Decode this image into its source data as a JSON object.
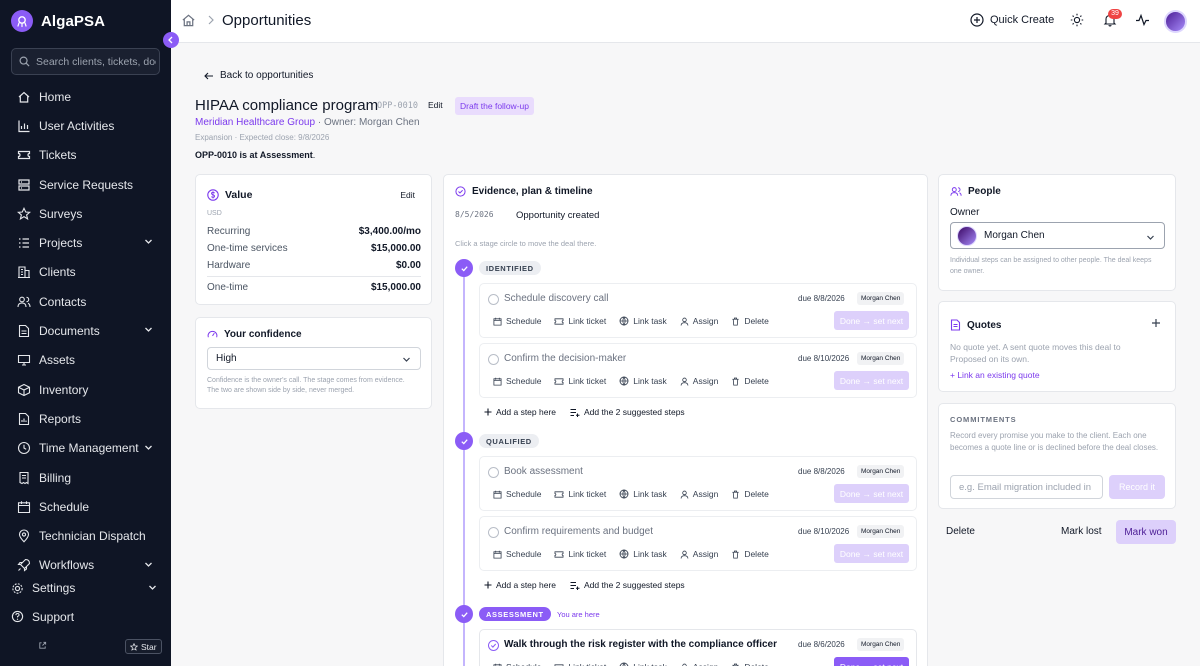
{
  "app": {
    "name": "AlgaPSA"
  },
  "search": {
    "placeholder": "Search clients, tickets, doc"
  },
  "nav": [
    {
      "label": "Home",
      "icon": "home-icon"
    },
    {
      "label": "User Activities",
      "icon": "chart-bar-icon"
    },
    {
      "label": "Tickets",
      "icon": "ticket-icon"
    },
    {
      "label": "Service Requests",
      "icon": "grid-icon"
    },
    {
      "label": "Surveys",
      "icon": "star-icon"
    },
    {
      "label": "Projects",
      "icon": "list-icon",
      "expandable": true
    },
    {
      "label": "Clients",
      "icon": "building-icon"
    },
    {
      "label": "Contacts",
      "icon": "users-icon"
    },
    {
      "label": "Documents",
      "icon": "document-icon",
      "expandable": true
    },
    {
      "label": "Assets",
      "icon": "monitor-icon"
    },
    {
      "label": "Inventory",
      "icon": "box-icon"
    },
    {
      "label": "Reports",
      "icon": "report-icon"
    },
    {
      "label": "Time Management",
      "icon": "clock-icon",
      "expandable": true
    },
    {
      "label": "Billing",
      "icon": "billing-icon"
    },
    {
      "label": "Schedule",
      "icon": "calendar-icon"
    },
    {
      "label": "Technician Dispatch",
      "icon": "pin-icon"
    },
    {
      "label": "Workflows",
      "icon": "rocket-icon",
      "expandable": true
    }
  ],
  "sidebar_bottom": {
    "settings": "Settings",
    "support": "Support",
    "star": "Star"
  },
  "topbar": {
    "title": "Opportunities",
    "quick_create": "Quick Create",
    "notif_count": "39"
  },
  "header": {
    "back": "Back to opportunities",
    "title": "HIPAA compliance program",
    "code": "OPP-0010",
    "edit": "Edit",
    "draft": "Draft the follow-up",
    "client": "Meridian Healthcare Group",
    "owner_line": " · Owner: Morgan Chen",
    "meta": "Expansion · Expected close: 9/8/2026",
    "stage_code": "OPP-0010 is at ",
    "stage_name": "Assessment",
    "stage_end": "."
  },
  "value_card": {
    "title": "Value",
    "edit": "Edit",
    "currency": "USD",
    "rows": [
      {
        "label": "Recurring",
        "value": "$3,400.00/mo"
      },
      {
        "label": "One-time services",
        "value": "$15,000.00"
      },
      {
        "label": "Hardware",
        "value": "$0.00"
      },
      {
        "label": "One-time",
        "value": "$15,000.00"
      }
    ]
  },
  "confidence": {
    "title": "Your confidence",
    "value": "High",
    "help": "Confidence is the owner's call. The stage comes from evidence. The two are shown side by side, never merged."
  },
  "evidence": {
    "title": "Evidence, plan & timeline",
    "created_date": "8/5/2026",
    "created_text": "Opportunity created",
    "help": "Click a stage circle to move the deal there.",
    "actions": {
      "schedule": "Schedule",
      "link_ticket": "Link ticket",
      "link_task": "Link task",
      "assign": "Assign",
      "delete": "Delete",
      "done": "Done → set next"
    },
    "add_step": "Add a step here",
    "add_suggested": "Add the 2 suggested steps",
    "you_are_here": "You are here",
    "stages": [
      {
        "name": "IDENTIFIED",
        "steps": [
          {
            "title": "Schedule discovery call",
            "due": "due 8/8/2026",
            "owner": "Morgan Chen"
          },
          {
            "title": "Confirm the decision-maker",
            "due": "due 8/10/2026",
            "owner": "Morgan Chen"
          }
        ]
      },
      {
        "name": "QUALIFIED",
        "steps": [
          {
            "title": "Book assessment",
            "due": "due 8/8/2026",
            "owner": "Morgan Chen"
          },
          {
            "title": "Confirm requirements and budget",
            "due": "due 8/10/2026",
            "owner": "Morgan Chen"
          }
        ]
      },
      {
        "name": "ASSESSMENT",
        "steps": [
          {
            "title": "Walk through the risk register with the compliance officer",
            "due": "due 8/6/2026",
            "owner": "Morgan Chen"
          }
        ]
      }
    ]
  },
  "people": {
    "title": "People",
    "owner_label": "Owner",
    "owner": "Morgan Chen",
    "help": "Individual steps can be assigned to other people. The deal keeps one owner."
  },
  "quotes": {
    "title": "Quotes",
    "help": "No quote yet. A sent quote moves this deal to Proposed on its own.",
    "link": "+ Link an existing quote"
  },
  "commitments": {
    "title": "COMMITMENTS",
    "help": "Record every promise you make to the client. Each one becomes a quote line or is declined before the deal closes.",
    "placeholder": "e.g. Email migration included in",
    "record": "Record it"
  },
  "footer_actions": {
    "delete": "Delete",
    "lost": "Mark lost",
    "won": "Mark won"
  },
  "colors": {
    "accent": "#8b5cf6",
    "sidebar": "#0f1525",
    "accent_light": "#ddd0fb"
  }
}
